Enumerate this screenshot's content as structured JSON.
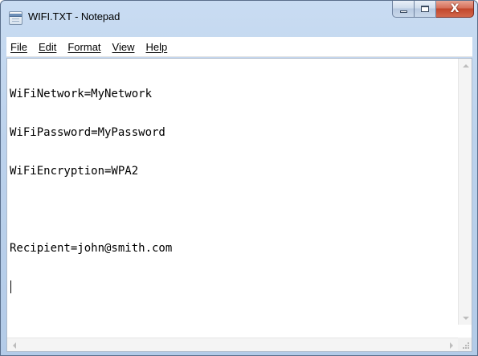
{
  "window": {
    "title": "WIFI.TXT - Notepad",
    "icon": "notepad-icon",
    "buttons": {
      "minimize": "minimize-icon",
      "maximize": "maximize-icon",
      "close": "close-icon"
    },
    "close_glyph": "X",
    "close_color": "#c2472c"
  },
  "menu": {
    "items": [
      {
        "label": "File"
      },
      {
        "label": "Edit"
      },
      {
        "label": "Format"
      },
      {
        "label": "View"
      },
      {
        "label": "Help"
      }
    ]
  },
  "editor": {
    "lines": [
      "WiFiNetwork=MyNetwork",
      "WiFiPassword=MyPassword",
      "WiFiEncryption=WPA2",
      "",
      "Recipient=john@smith.com"
    ]
  }
}
